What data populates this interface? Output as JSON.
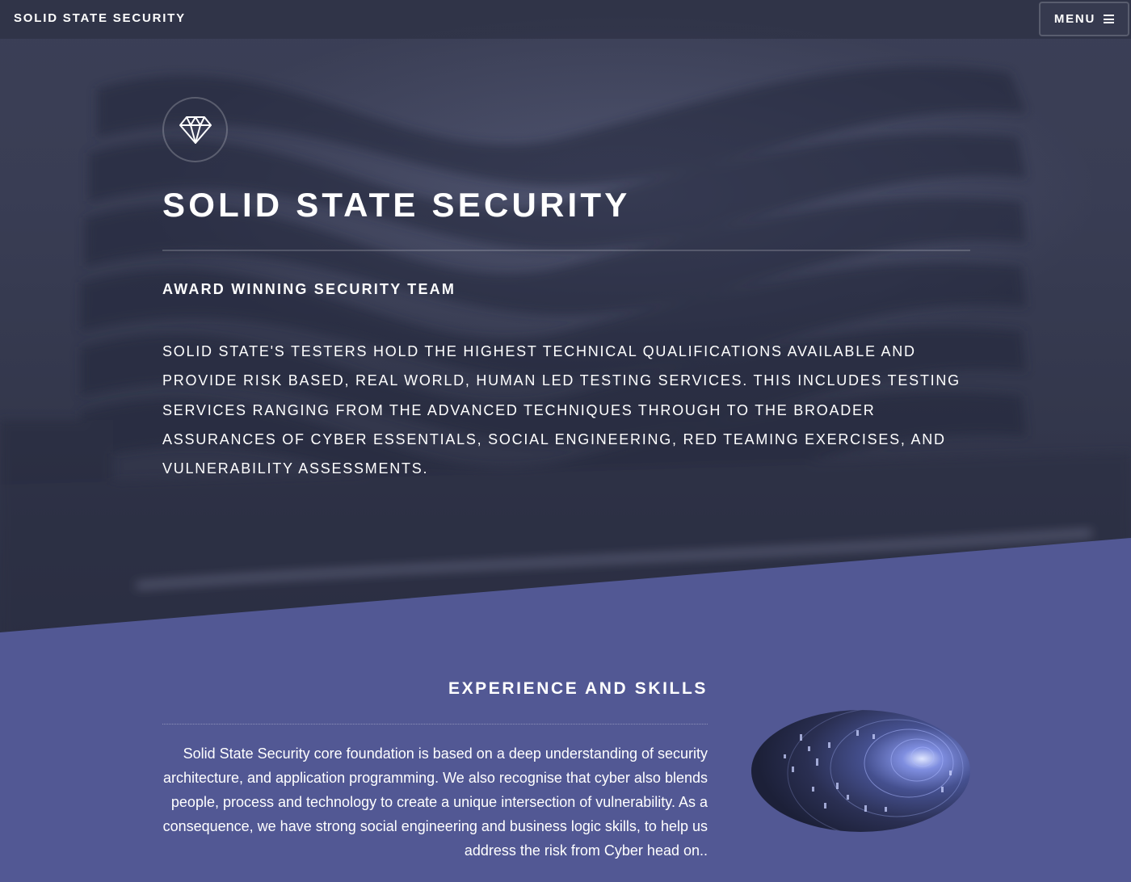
{
  "header": {
    "brand": "SOLID STATE SECURITY",
    "menu_label": "MENU"
  },
  "hero": {
    "title": "SOLID STATE SECURITY",
    "subtitle": "AWARD WINNING SECURITY TEAM",
    "description": "Solid State's testers hold the highest technical qualifications available and provide risk based, real world, human led testing services. This includes testing services ranging from the advanced techniques through to the broader assurances of cyber essentials, social engineering, red teaming exercises, and vulnerability assessments."
  },
  "experience": {
    "title": "EXPERIENCE AND SKILLS",
    "description": "Solid State Security core foundation is based on a deep understanding of security architecture, and application programming. We also recognise that cyber also blends people, process and technology to create a unique intersection of vulnerability. As a consequence, we have strong social engineering and business logic skills, to help us address the risk from Cyber head on.."
  },
  "icons": {
    "logo": "diamond-icon",
    "menu": "hamburger-icon",
    "image": "cyber-tunnel-image"
  },
  "colors": {
    "hero_bg": "#393d54",
    "accent_purple": "#525894",
    "text": "#ffffff"
  }
}
